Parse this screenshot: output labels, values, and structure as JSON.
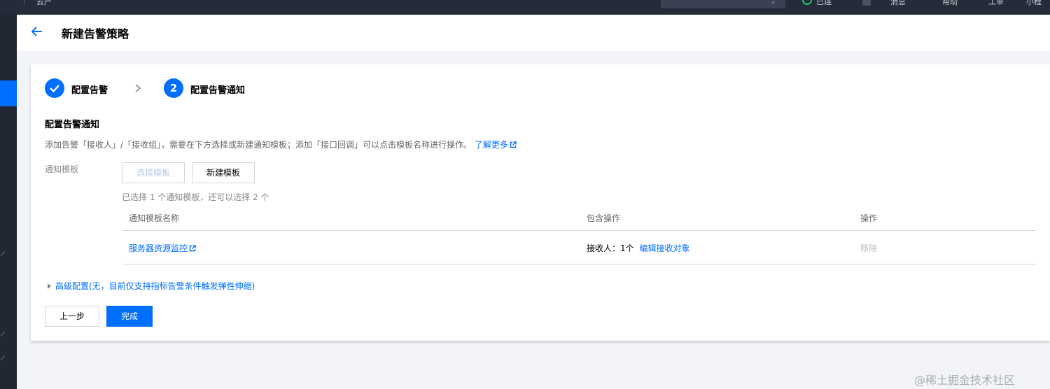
{
  "topbar": {
    "left_text": "云产",
    "items": [
      "已连",
      "消息",
      "帮助",
      "工单",
      "小程"
    ]
  },
  "header": {
    "title": "新建告警策略"
  },
  "steps": [
    {
      "number": "✓",
      "label": "配置告警",
      "status": "done"
    },
    {
      "number": "2",
      "label": "配置告警通知",
      "status": "active"
    }
  ],
  "section": {
    "title": "配置告警通知",
    "description": "添加告警「接收人」/「接收组」，需要在下方选择或新建通知模板；添加「接口回调」可以点击模板名称进行操作。",
    "learn_more": "了解更多"
  },
  "form": {
    "field_label": "通知模板",
    "select_template_btn": "选择模板",
    "new_template_btn": "新建模板",
    "hint": "已选择 1 个通知模板，还可以选择 2 个"
  },
  "table": {
    "columns": [
      "通知模板名称",
      "包含操作",
      "操作"
    ],
    "rows": [
      {
        "name": "服务器资源监控",
        "receivers_prefix": "接收人：1个",
        "edit_receivers": "编辑接收对象",
        "remove": "移除"
      }
    ]
  },
  "advanced": {
    "label": "高级配置(无，目前仅支持指标告警条件触发弹性伸缩)"
  },
  "actions": {
    "prev": "上一步",
    "finish": "完成"
  },
  "watermark": "@稀土掘金技术社区",
  "colors": {
    "primary": "#006eff",
    "topbar_bg": "#262b39",
    "sidebar_bg": "#222734",
    "page_bg": "#f3f4f7"
  }
}
